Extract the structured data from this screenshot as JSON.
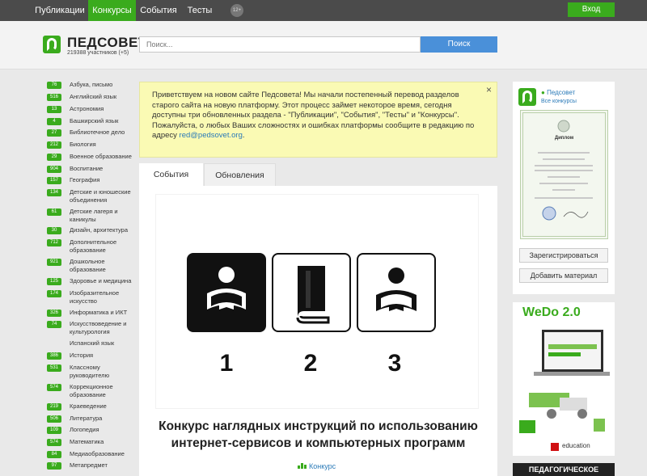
{
  "topnav": {
    "items": [
      "Публикации",
      "Конкурсы",
      "События",
      "Тесты"
    ],
    "age": "12+",
    "login": "Вход"
  },
  "header": {
    "logo_title": "ПЕДСОВЕТ",
    "logo_sub": "219388 участников (+5)",
    "search_placeholder": "Поиск...",
    "search_button": "Поиск"
  },
  "categories": [
    {
      "count": "76",
      "name": "Азбука, письмо"
    },
    {
      "count": "516",
      "name": "Английский язык"
    },
    {
      "count": "13",
      "name": "Астрономия"
    },
    {
      "count": "4",
      "name": "Башкирский язык"
    },
    {
      "count": "27",
      "name": "Библиотечное дело"
    },
    {
      "count": "212",
      "name": "Биология"
    },
    {
      "count": "29",
      "name": "Военное образование"
    },
    {
      "count": "904",
      "name": "Воспитание"
    },
    {
      "count": "157",
      "name": "География"
    },
    {
      "count": "134",
      "name": "Детские и юношеские объединения"
    },
    {
      "count": "61",
      "name": "Детские лагеря и каникулы"
    },
    {
      "count": "30",
      "name": "Дизайн, архитектура"
    },
    {
      "count": "712",
      "name": "Дополнительное образование"
    },
    {
      "count": "921",
      "name": "Дошкольное образование"
    },
    {
      "count": "125",
      "name": "Здоровье и медицина"
    },
    {
      "count": "174",
      "name": "Изобразительное искусство"
    },
    {
      "count": "326",
      "name": "Информатика и ИКТ"
    },
    {
      "count": "74",
      "name": "Искусствоведение и культурология"
    },
    {
      "count": "",
      "name": "Испанский язык"
    },
    {
      "count": "386",
      "name": "История"
    },
    {
      "count": "531",
      "name": "Классному руководителю"
    },
    {
      "count": "574",
      "name": "Коррекционное образование"
    },
    {
      "count": "219",
      "name": "Краеведение"
    },
    {
      "count": "506",
      "name": "Литература"
    },
    {
      "count": "109",
      "name": "Логопедия"
    },
    {
      "count": "574",
      "name": "Математика"
    },
    {
      "count": "84",
      "name": "Медиаобразование"
    },
    {
      "count": "97",
      "name": "Метапредмет"
    }
  ],
  "notice": {
    "text": "Приветствуем на новом сайте Педсовета! Мы начали постепенный перевод разделов старого сайта на новую платформу. Этот процесс займет некоторое время, сегодня доступны три обновленных раздела - \"Публикации\", \"События\", \"Тесты\" и \"Конкурсы\". Пожалуйста, о любых Ваших сложностях и ошибках платформы  сообщите в редакцию по адресу ",
    "email": "red@pedsovet.org",
    "tail": ".",
    "close": "×"
  },
  "tabs": [
    "События",
    "Обновления"
  ],
  "contest": {
    "numbers": [
      "1",
      "2",
      "3"
    ],
    "title_line1": "Конкурс наглядных инструкций по использованию",
    "title_line2": "интернет-сервисов и компьютерных программ",
    "link": "Конкурс"
  },
  "profile": {
    "name": "Педсовет",
    "all_contests": "Все конкурсы",
    "diploma_title": "Диплом",
    "register_button": "Зарегистрироваться",
    "add_material_button": "Добавить материал"
  },
  "ads": {
    "wedo_title": "WeDo 2.0",
    "lego_text": "education",
    "banner_text": "ПЕДАГОГИЧЕСКОЕ"
  }
}
